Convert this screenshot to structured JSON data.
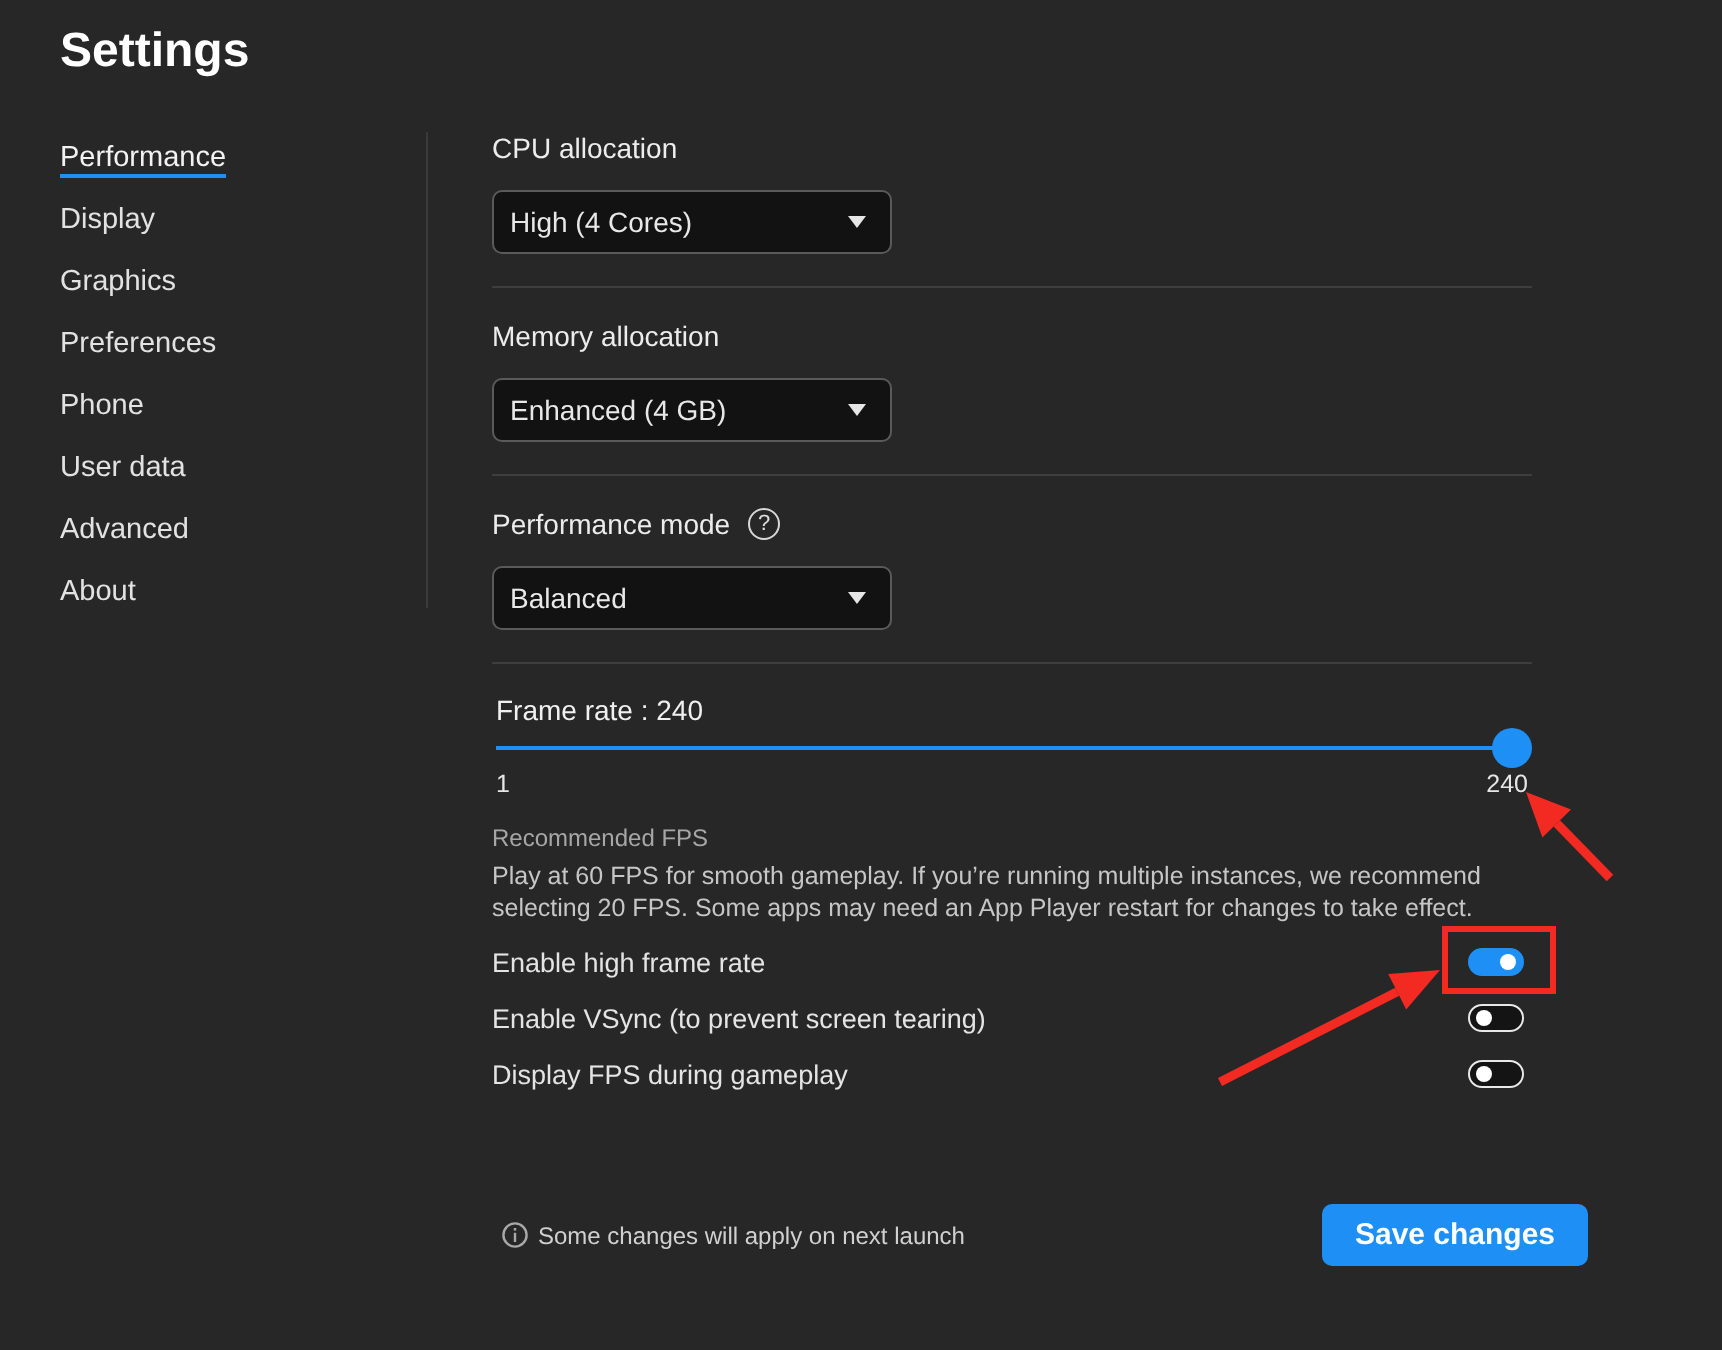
{
  "window": {
    "title": "Settings"
  },
  "sidebar": {
    "items": [
      {
        "label": "Performance",
        "selected": true
      },
      {
        "label": "Display",
        "selected": false
      },
      {
        "label": "Graphics",
        "selected": false
      },
      {
        "label": "Preferences",
        "selected": false
      },
      {
        "label": "Phone",
        "selected": false
      },
      {
        "label": "User data",
        "selected": false
      },
      {
        "label": "Advanced",
        "selected": false
      },
      {
        "label": "About",
        "selected": false
      }
    ]
  },
  "settings": [
    {
      "kind": "dropdown",
      "label": "CPU allocation",
      "value": "High (4 Cores)"
    },
    {
      "kind": "dropdown",
      "label": "Memory allocation",
      "value": "Enhanced (4 GB)"
    },
    {
      "kind": "dropdown",
      "label": "Performance mode",
      "help": "?",
      "value": "Balanced"
    }
  ],
  "frame_rate": {
    "label": "Frame rate : 240",
    "level": 1,
    "min_label": "1",
    "max_label": "240",
    "arrow_to_max": true,
    "hint_title": "Recommended FPS",
    "hint": "Play at 60 FPS for smooth gameplay. If you’re running multiple instances, we recommend selecting 20 FPS. Some apps may need an App Player restart for changes to take effect."
  },
  "toggles": [
    {
      "label": "Enable high frame rate",
      "on": true,
      "highlighted": true
    },
    {
      "label": "Enable VSync (to prevent screen tearing)",
      "on": false,
      "highlighted": false
    },
    {
      "label": "Display FPS during gameplay",
      "on": false,
      "highlighted": false
    }
  ],
  "footer": {
    "note": "Some changes will apply on next launch",
    "button": "Save changes"
  }
}
